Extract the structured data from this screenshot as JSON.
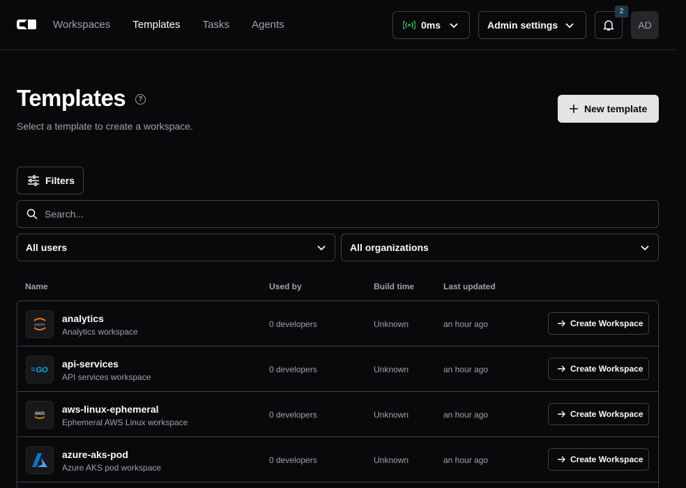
{
  "nav": {
    "items": [
      {
        "label": "Workspaces",
        "active": false
      },
      {
        "label": "Templates",
        "active": true
      },
      {
        "label": "Tasks",
        "active": false
      },
      {
        "label": "Agents",
        "active": false
      }
    ],
    "latency": "0ms",
    "admin_label": "Admin settings",
    "notification_count": "2",
    "avatar_initials": "AD"
  },
  "header": {
    "title": "Templates",
    "help_glyph": "?",
    "subtitle": "Select a template to create a workspace.",
    "new_button": "New template"
  },
  "filters": {
    "button_label": "Filters",
    "search_placeholder": "Search...",
    "users_select": "All users",
    "orgs_select": "All organizations"
  },
  "table": {
    "columns": [
      "Name",
      "Used by",
      "Build time",
      "Last updated"
    ],
    "action_label": "Create Workspace",
    "rows": [
      {
        "name": "analytics",
        "description": "Analytics workspace",
        "icon": "jupyter-icon",
        "used_by": "0 developers",
        "build_time": "Unknown",
        "last_updated": "an hour ago"
      },
      {
        "name": "api-services",
        "description": "API services workspace",
        "icon": "go-icon",
        "used_by": "0 developers",
        "build_time": "Unknown",
        "last_updated": "an hour ago"
      },
      {
        "name": "aws-linux-ephemeral",
        "description": "Ephemeral AWS Linux workspace",
        "icon": "aws-icon",
        "used_by": "0 developers",
        "build_time": "Unknown",
        "last_updated": "an hour ago"
      },
      {
        "name": "azure-aks-pod",
        "description": "Azure AKS pod workspace",
        "icon": "azure-icon",
        "used_by": "0 developers",
        "build_time": "Unknown",
        "last_updated": "an hour ago"
      }
    ]
  },
  "icon_text": {
    "jupyter": "jupyter",
    "go": "GO",
    "aws": "aws"
  },
  "colors": {
    "accent_green": "#22c55e",
    "go_blue": "#00add8",
    "azure_blue": "#0078d4",
    "jupyter_orange": "#f37726"
  }
}
